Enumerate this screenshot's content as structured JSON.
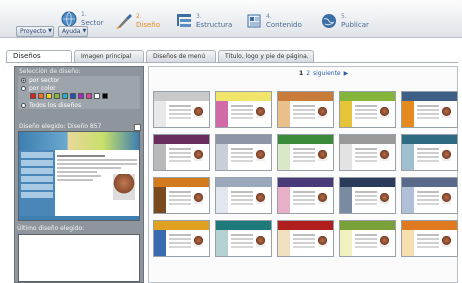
{
  "toolbar": {
    "proyecto_label": "Proyecto",
    "ayuda_label": "Ayuda",
    "steps": [
      {
        "number": "1.",
        "label": "Sector",
        "icon": "globe-icon"
      },
      {
        "number": "2.",
        "label": "Diseño",
        "icon": "paintbrush-icon"
      },
      {
        "number": "3.",
        "label": "Estructura",
        "icon": "structure-icon"
      },
      {
        "number": "4.",
        "label": "Contenido",
        "icon": "content-icon"
      },
      {
        "number": "5.",
        "label": "Publicar",
        "icon": "publish-globe-icon"
      }
    ],
    "active_step_color": "#e58a1f"
  },
  "tabs": [
    {
      "label": "Diseños"
    },
    {
      "label": "Imagen principal"
    },
    {
      "label": "Diseños de menú"
    },
    {
      "label": "Título, logo y pie de página."
    }
  ],
  "left": {
    "filter_title": "Selección de diseño:",
    "radio_sector": "por sector",
    "radio_color": "por color",
    "radio_all": "Todos los diseños",
    "swatch_colors": [
      "#e02020",
      "#f07020",
      "#f4d020",
      "#80c030",
      "#20b0d0",
      "#2050c0",
      "#a030b0",
      "#e040a0",
      "#ffffff",
      "#000000"
    ],
    "selected_title": "Diseño elegido: Diseño 857",
    "last_title": "Último diseño elegido:"
  },
  "pager": {
    "current": "1",
    "next_page": "2",
    "next_label": "siguiente"
  },
  "thumbnails": [
    {
      "header": "#c9c9c9",
      "side": "#e9e9e9"
    },
    {
      "header": "#f0e46a",
      "side": "#d36aa8"
    },
    {
      "header": "#c97b3a",
      "side": "#e9c08a"
    },
    {
      "header": "#84b43a",
      "side": "#e6c43a"
    },
    {
      "header": "#3e5f86",
      "side": "#e58a1f"
    },
    {
      "header": "#6a2e5e",
      "side": "#b9b9b9"
    },
    {
      "header": "#8c96a6",
      "side": "#c9cfd8"
    },
    {
      "header": "#3a8a3a",
      "side": "#d8e8c8"
    },
    {
      "header": "#9a9a9a",
      "side": "#e3e3e3"
    },
    {
      "header": "#2e6a82",
      "side": "#9ec0d0"
    },
    {
      "header": "#d47a1e",
      "side": "#7a4a1e"
    },
    {
      "header": "#9aa8bc",
      "side": "#e2e6ee"
    },
    {
      "header": "#4a3a7a",
      "side": "#e8b0c8"
    },
    {
      "header": "#2a3a5a",
      "side": "#7a8aa0"
    },
    {
      "header": "#5a6a8a",
      "side": "#b0c0d8"
    },
    {
      "header": "#e0a020",
      "side": "#3a6ab0"
    },
    {
      "header": "#1e7a7a",
      "side": "#b4d0d0"
    },
    {
      "header": "#b01e1e",
      "side": "#f0e0c0"
    },
    {
      "header": "#7aa03a",
      "side": "#f0f0c0"
    },
    {
      "header": "#e07a20",
      "side": "#f6e0b0"
    }
  ]
}
